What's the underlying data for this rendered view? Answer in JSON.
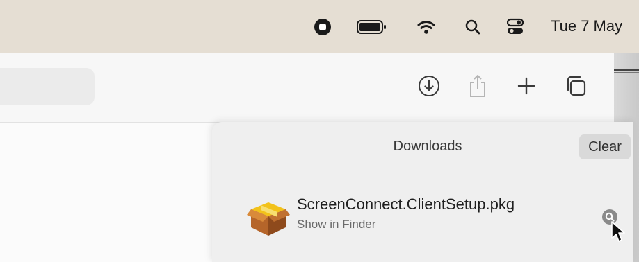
{
  "menubar": {
    "icons": [
      "record-icon",
      "battery-icon",
      "wifi-icon",
      "search-icon",
      "control-center-icon"
    ],
    "date": "Tue 7 May"
  },
  "toolbar": {
    "icons": [
      "downloads-icon",
      "share-icon",
      "new-tab-icon",
      "tab-overview-icon"
    ]
  },
  "downloads": {
    "title": "Downloads",
    "clear_label": "Clear",
    "items": [
      {
        "file_name": "ScreenConnect.ClientSetup.pkg",
        "action_label": "Show in Finder",
        "icon": "package-icon"
      }
    ]
  },
  "colors": {
    "menubar": "#e5ded3",
    "toolbar": "#f7f7f7",
    "popover": "#efefef",
    "clear_button": "#d9d9d9"
  }
}
